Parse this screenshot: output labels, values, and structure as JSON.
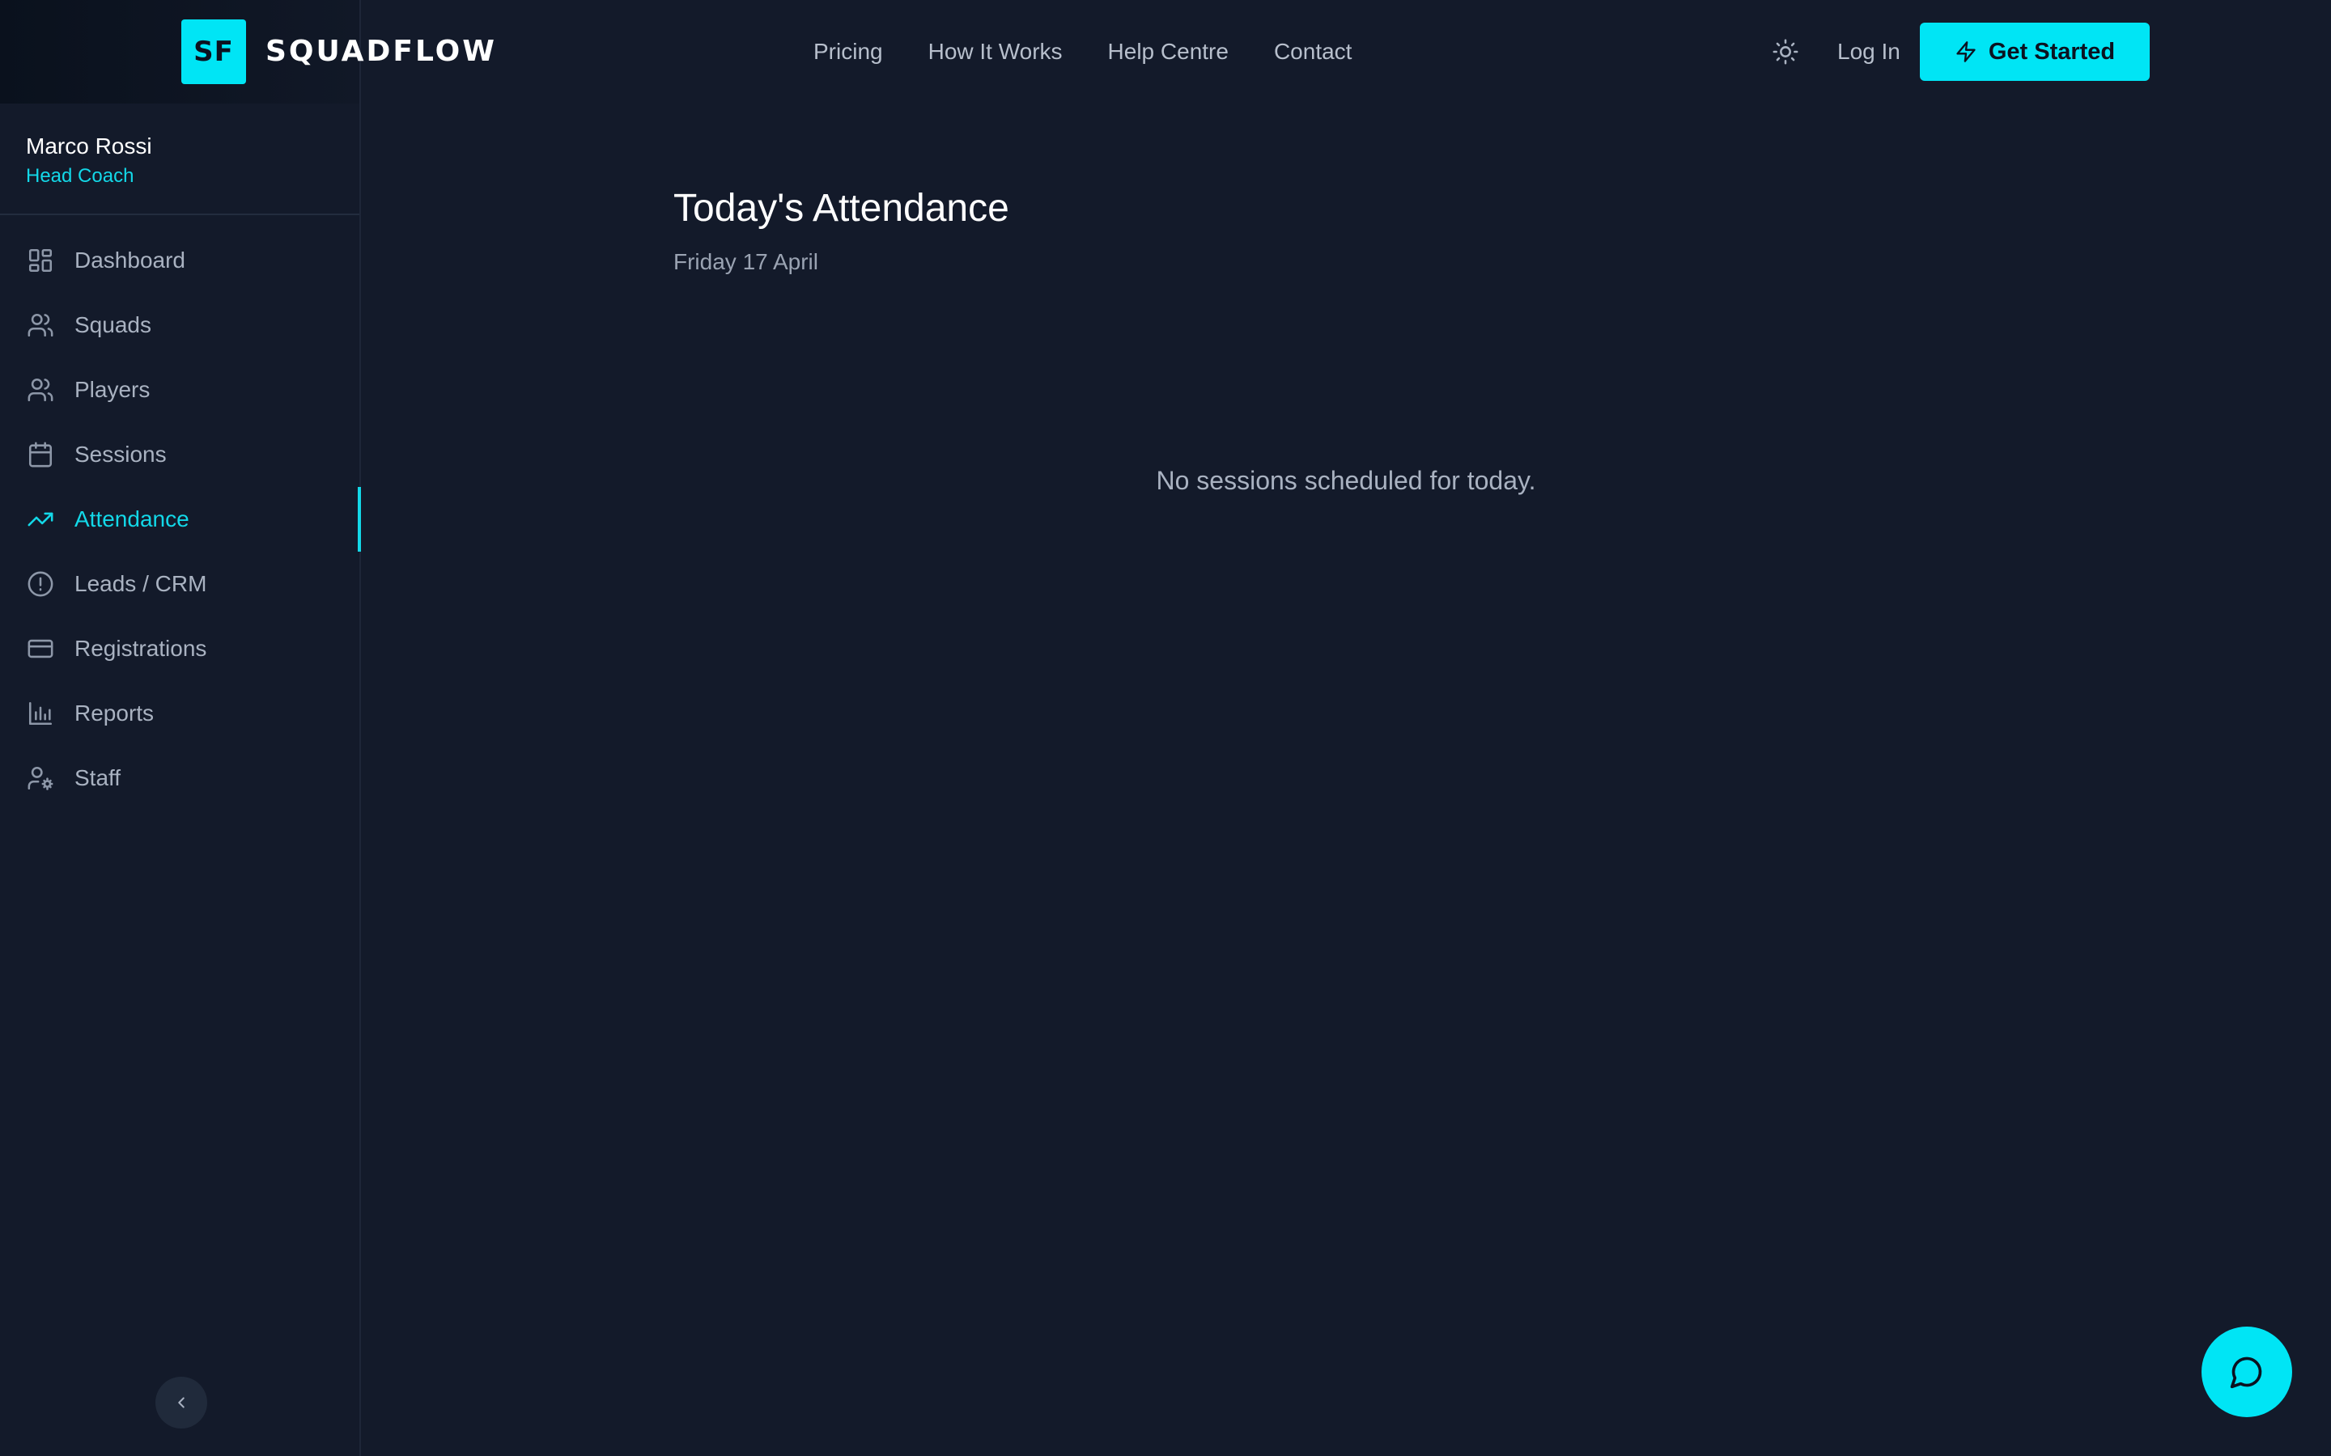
{
  "brand": {
    "badge": "SF",
    "name": "SQUADFLOW"
  },
  "user": {
    "name": "Marco Rossi",
    "role": "Head Coach"
  },
  "sidebar": {
    "items": [
      {
        "label": "Dashboard",
        "icon": "dashboard-icon",
        "active": false
      },
      {
        "label": "Squads",
        "icon": "users-icon",
        "active": false
      },
      {
        "label": "Players",
        "icon": "users-icon",
        "active": false
      },
      {
        "label": "Sessions",
        "icon": "calendar-icon",
        "active": false
      },
      {
        "label": "Attendance",
        "icon": "trending-up-icon",
        "active": true
      },
      {
        "label": "Leads / CRM",
        "icon": "alert-circle-icon",
        "active": false
      },
      {
        "label": "Registrations",
        "icon": "credit-card-icon",
        "active": false
      },
      {
        "label": "Reports",
        "icon": "bar-chart-icon",
        "active": false
      },
      {
        "label": "Staff",
        "icon": "user-cog-icon",
        "active": false
      }
    ],
    "collapse_icon": "chevron-left-icon"
  },
  "header": {
    "nav": [
      "Pricing",
      "How It Works",
      "Help Centre",
      "Contact"
    ],
    "login_label": "Log In",
    "cta_label": "Get Started",
    "theme_icon": "sun-icon"
  },
  "main": {
    "title": "Today's Attendance",
    "date": "Friday 17 April",
    "empty_message": "No sessions scheduled for today."
  },
  "colors": {
    "accent": "#00e5f5",
    "background": "#131a2a",
    "sidebar_active": "#13d8e8"
  }
}
